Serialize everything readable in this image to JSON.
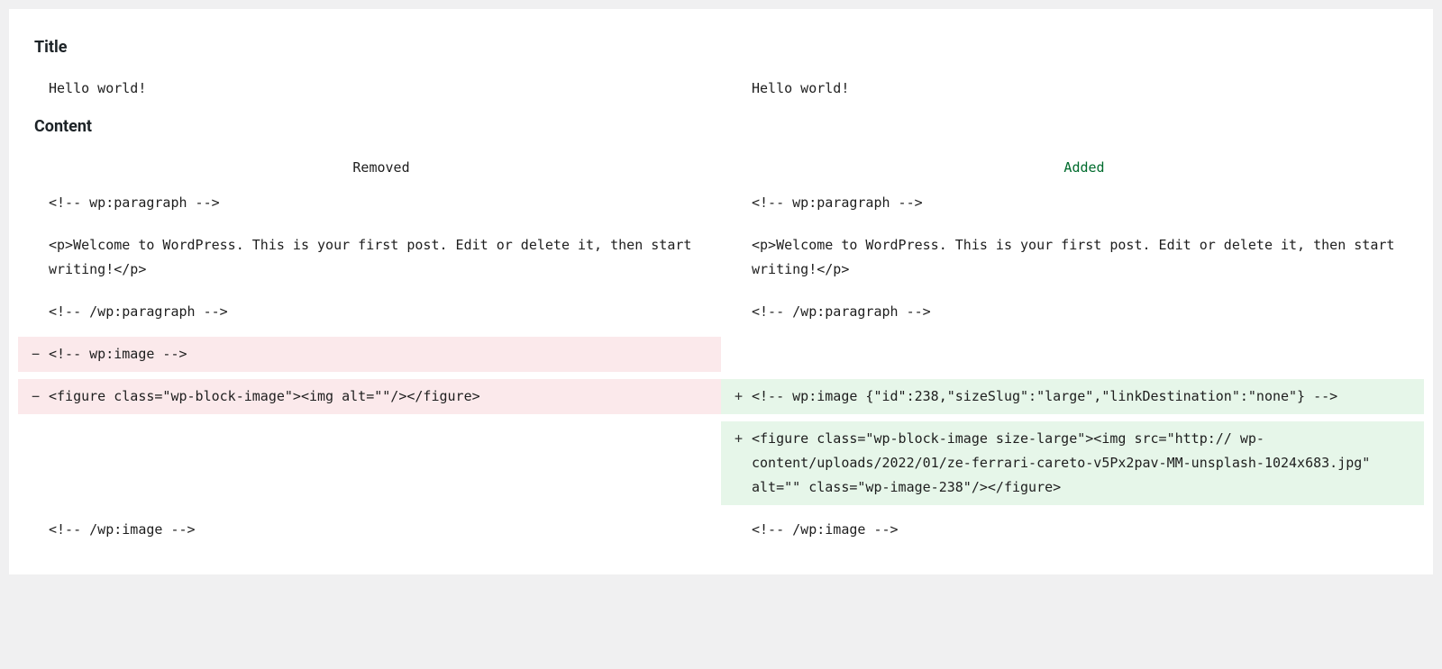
{
  "sections": {
    "title_heading": "Title",
    "content_heading": "Content"
  },
  "column_headers": {
    "removed": "Removed",
    "added": "Added"
  },
  "title_diff": {
    "left": "Hello world!",
    "right": "Hello world!"
  },
  "content_diff": {
    "rows": [
      {
        "type": "context",
        "left_marker": "",
        "left": "<!-- wp:paragraph -->",
        "right_marker": "",
        "right": "<!-- wp:paragraph -->"
      },
      {
        "type": "context",
        "left_marker": "",
        "left": "<p>Welcome to WordPress. This is your first post. Edit or delete it, then start writing!</p>",
        "right_marker": "",
        "right": "<p>Welcome to WordPress. This is your first post. Edit or delete it, then start writing!</p>"
      },
      {
        "type": "context",
        "left_marker": "",
        "left": "<!-- /wp:paragraph -->",
        "right_marker": "",
        "right": "<!-- /wp:paragraph -->"
      },
      {
        "type": "removed",
        "left_marker": "−",
        "left": "<!-- wp:image -->",
        "right_marker": "",
        "right": ""
      },
      {
        "type": "changed",
        "left_marker": "−",
        "left": "<figure class=\"wp-block-image\"><img alt=\"\"/></figure>",
        "right_marker": "+",
        "right": "<!-- wp:image {\"id\":238,\"sizeSlug\":\"large\",\"linkDestination\":\"none\"} -->"
      },
      {
        "type": "added",
        "left_marker": "",
        "left": "",
        "right_marker": "+",
        "right": "<figure class=\"wp-block-image size-large\"><img src=\"http://               wp-content/uploads/2022/01/ze-ferrari-careto-v5Px2pav-MM-unsplash-1024x683.jpg\" alt=\"\" class=\"wp-image-238\"/></figure>"
      },
      {
        "type": "context",
        "left_marker": "",
        "left": "<!-- /wp:image -->",
        "right_marker": "",
        "right": "<!-- /wp:image -->"
      }
    ]
  }
}
